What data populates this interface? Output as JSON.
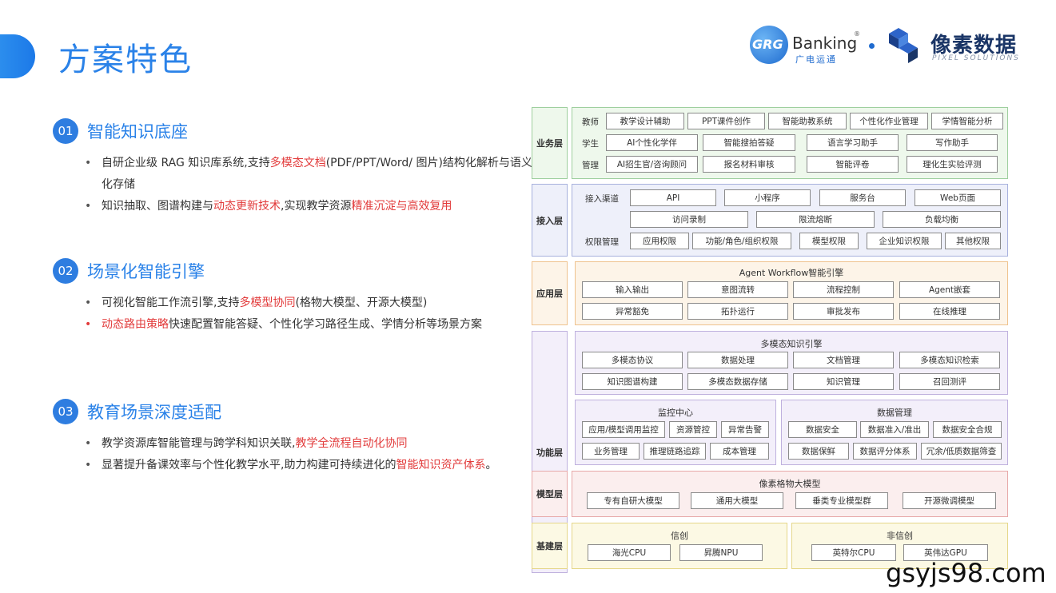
{
  "header": {
    "title": "方案特色",
    "logo_grg": "GRG",
    "logo_banking": "Banking",
    "logo_banking_reg": "®",
    "logo_banking_cn": "广电运通",
    "logo_pixel_cn": "像素数据",
    "logo_pixel_en": "PIXEL SOLUTIONS"
  },
  "sections": [
    {
      "num": "01",
      "title": "智能知识底座",
      "bullets": [
        [
          {
            "t": "自研企业级 RAG 知识库系统,支持"
          },
          {
            "t": "多模态文档",
            "hl": true
          },
          {
            "t": "(PDF/PPT/Word/ 图片)结构化解析与语义化存储"
          }
        ],
        [
          {
            "t": "知识抽取、图谱构建与"
          },
          {
            "t": "动态更新技术",
            "hl": true
          },
          {
            "t": ",实现教学资源"
          },
          {
            "t": "精准沉淀与高效复用",
            "hl": true
          }
        ]
      ]
    },
    {
      "num": "02",
      "title": "场景化智能引擎",
      "bullets": [
        [
          {
            "t": "可视化智能工作流引擎,支持"
          },
          {
            "t": "多模型协同",
            "hl": true
          },
          {
            "t": "(格物大模型、开源大模型)"
          }
        ],
        [
          {
            "t": "动态路由策略",
            "hl": true
          },
          {
            "t": "快速配置智能答疑、个性化学习路径生成、学情分析等场景方案"
          }
        ]
      ]
    },
    {
      "num": "03",
      "title": "教育场景深度适配",
      "bullets": [
        [
          {
            "t": "教学资源库智能管理与跨学科知识关联,"
          },
          {
            "t": "教学全流程自动化协同",
            "hl": true
          }
        ],
        [
          {
            "t": "显著提升备课效率与个性化教学水平,助力构建可持续进化的"
          },
          {
            "t": "智能知识资产体系",
            "hl": true
          },
          {
            "t": "。"
          }
        ]
      ]
    }
  ],
  "diagram": {
    "business": {
      "label": "业务层",
      "rows": [
        {
          "name": "教师",
          "items": [
            "教学设计辅助",
            "PPT课件创作",
            "智能助教系统",
            "个性化作业管理",
            "学情智能分析"
          ]
        },
        {
          "name": "学生",
          "items": [
            "AI个性化学伴",
            "智能搜拍答疑",
            "语言学习助手",
            "写作助手"
          ]
        },
        {
          "name": "管理",
          "items": [
            "AI招生官/咨询顾问",
            "报名材料审核",
            "智能评卷",
            "理化生实验评测"
          ]
        }
      ]
    },
    "access": {
      "label": "接入层",
      "channel_name": "接入渠道",
      "channels": [
        "API",
        "小程序",
        "服务台",
        "Web页面"
      ],
      "channels2": [
        "访问录制",
        "限流熔断",
        "负载均衡"
      ],
      "perm_name": "权限管理",
      "perms": [
        "应用权限",
        "功能/角色/组织权限",
        "模型权限",
        "企业知识权限",
        "其他权限"
      ]
    },
    "app": {
      "label": "应用层",
      "title": "Agent Workflow智能引擎",
      "row1": [
        "输入输出",
        "意图流转",
        "流程控制",
        "Agent嵌套"
      ],
      "row2": [
        "异常豁免",
        "拓扑运行",
        "审批发布",
        "在线推理"
      ]
    },
    "func": {
      "label": "功能层",
      "engine_title": "多模态知识引擎",
      "engine_row1": [
        "多模态协议",
        "数据处理",
        "文档管理",
        "多模态知识检索"
      ],
      "engine_row2": [
        "知识图谱构建",
        "多模态数据存储",
        "知识管理",
        "召回测评"
      ],
      "monitor_title": "监控中心",
      "monitor_row1": [
        "应用/模型调用监控",
        "资源管控",
        "异常告警"
      ],
      "monitor_row2": [
        "业务管理",
        "推理链路追踪",
        "成本管理"
      ],
      "data_title": "数据管理",
      "data_row1": [
        "数据安全",
        "数据准入/准出",
        "数据安全合规"
      ],
      "data_row2": [
        "数据保鲜",
        "数据评分体系",
        "冗余/低质数据筛查"
      ]
    },
    "model": {
      "label": "模型层",
      "title": "像素格物大模型",
      "items": [
        "专有自研大模型",
        "通用大模型",
        "垂类专业模型群",
        "开源微调模型"
      ]
    },
    "infra": {
      "label": "基建层",
      "xc_title": "信创",
      "xc_items": [
        "海光CPU",
        "昇腾NPU"
      ],
      "fxc_title": "非信创",
      "fxc_items": [
        "英特尔CPU",
        "英伟达GPU"
      ]
    }
  },
  "watermark": "gsyjs98.com",
  "colors": {
    "accent_blue": "#2a82e8",
    "highlight_red": "#e23b3b",
    "business_green": "#eef8ec",
    "access_blue": "#eef0fa",
    "app_orange": "#fdf4e8",
    "func_purple": "#f3effa",
    "model_pink": "#fbeeee",
    "infra_yellow": "#fcf9e4"
  }
}
